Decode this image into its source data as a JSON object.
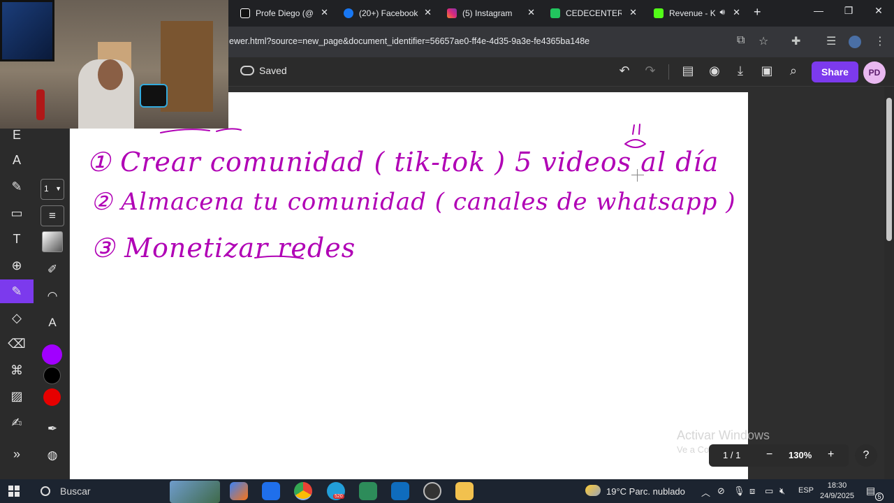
{
  "browser": {
    "tabs": [
      {
        "title": "Profe Diego (@",
        "favicon": "tiktok-icon",
        "color": "#111111"
      },
      {
        "title": "(20+) Facebook",
        "favicon": "facebook-icon",
        "color": "#1877f2"
      },
      {
        "title": "(5) Instagram",
        "favicon": "instagram-icon",
        "color": "#e1306c"
      },
      {
        "title": "CEDECENTER | M",
        "favicon": "cedecenter-icon",
        "color": "#22c55e"
      },
      {
        "title": "Revenue - K",
        "favicon": "kick-icon",
        "color": "#53fc18"
      }
    ],
    "url": "ewer.html?source=new_page&document_identifier=56657ae0-ff4e-4d35-9a3e-fe4365ba148e"
  },
  "toolbar": {
    "saved_label": "Saved",
    "share_label": "Share",
    "avatar_initials": "PD"
  },
  "tools": {
    "stroke_width": "1",
    "colors": [
      "#a100ff",
      "#000000",
      "#e60000"
    ]
  },
  "canvas": {
    "ink_color": "#b000b5",
    "handwriting": [
      "① Crear comunidad ( tik-tok ) 5 videos al día",
      "② Almacena tu comunidad ( canales de whatsapp )",
      "③ Monetizar redes"
    ]
  },
  "watermark": {
    "line1": "Activar Windows",
    "line2": "Ve a Configuración para activar Windows."
  },
  "zoom": {
    "page_indicator": "1 / 1",
    "minus": "−",
    "level": "130%",
    "plus": "+",
    "help": "?"
  },
  "taskbar": {
    "search_label": "Buscar",
    "telegram_badge": "520",
    "weather": "19°C  Parc. nublado",
    "language": "ESP",
    "time": "18:30",
    "date": "24/9/2025",
    "notifications": "5"
  }
}
